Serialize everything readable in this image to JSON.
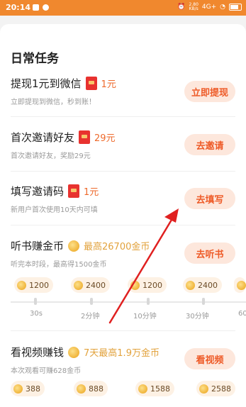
{
  "status": {
    "time": "20:14",
    "network_speed": "2.80",
    "network_unit": "KB/s",
    "signal": "4G+",
    "battery_label": "battery"
  },
  "section_title": "日常任务",
  "tasks": [
    {
      "title": "提现1元到微信",
      "reward_icon": "red-envelope-icon",
      "reward": "1元",
      "subtitle": "立即提现到微信，秒到账！",
      "button": "立即提现"
    },
    {
      "title": "首次邀请好友",
      "reward_icon": "red-envelope-icon",
      "reward": "29元",
      "subtitle": "首次邀请好友，奖励29元",
      "button": "去邀请"
    },
    {
      "title": "填写邀请码",
      "reward_icon": "red-envelope-icon",
      "reward": "1元",
      "subtitle": "新用户首次使用10天内可填",
      "button": "去填写"
    },
    {
      "title": "听书赚金币",
      "reward_icon": "gold-coin-icon",
      "reward": "最高26700金币",
      "subtitle": "听完本时段，最高得1500金币",
      "button": "去听书"
    },
    {
      "title": "看视频赚钱",
      "reward_icon": "gold-coin-icon",
      "reward": "7天最高1.9万金币",
      "subtitle": "本次观看可赚628金币",
      "button": "看视频"
    }
  ],
  "listen_timeline": {
    "rewards": [
      "1200",
      "2400",
      "1200",
      "2400"
    ],
    "durations": [
      "30s",
      "2分钟",
      "10分钟",
      "30分钟",
      "60"
    ]
  },
  "video_rewards": [
    "388",
    "888",
    "1588",
    "2588"
  ],
  "colors": {
    "accent": "#f0882e",
    "button_text": "#ee5b28",
    "button_bg": "#fde7dc",
    "arrow": "#e02020"
  }
}
